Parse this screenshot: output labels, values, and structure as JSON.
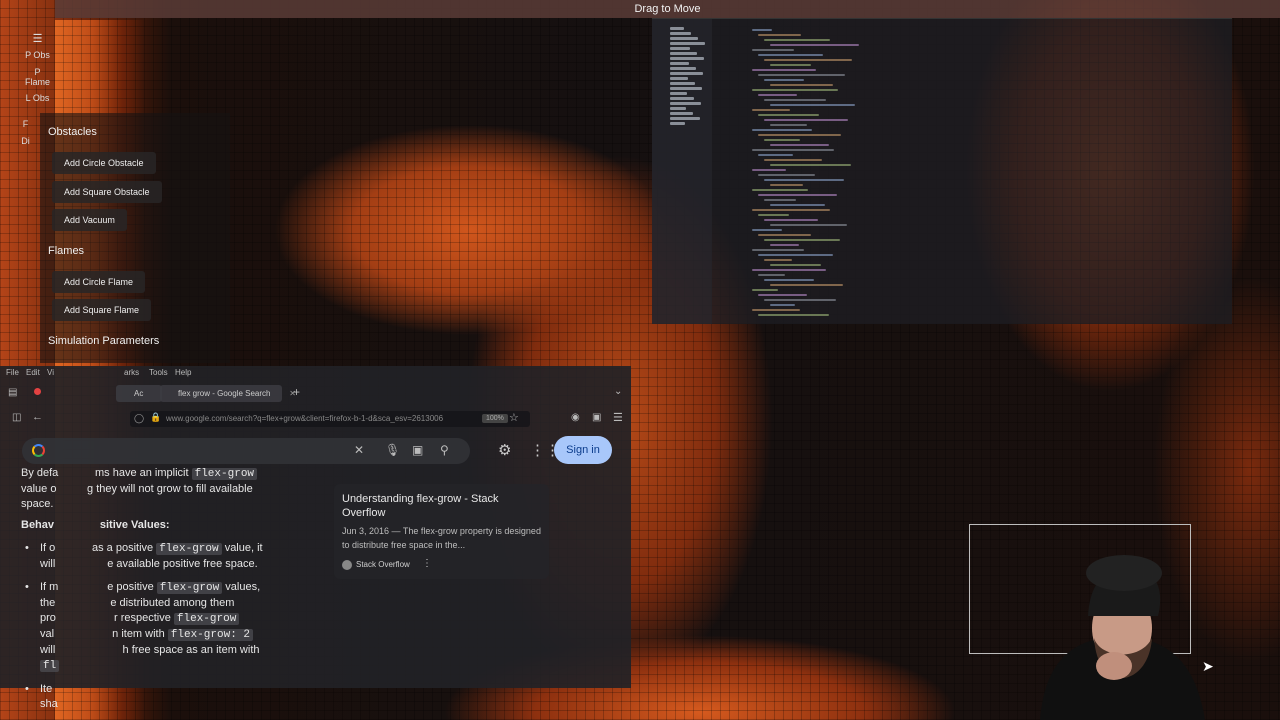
{
  "drag_bar": {
    "label": "Drag to Move"
  },
  "mini_toolbar": {
    "menu_icon": "hamburger-icon",
    "items": [
      "P Obs",
      "P",
      "Flame",
      "L Obs",
      "F",
      "Di"
    ]
  },
  "panel": {
    "obstacles_title": "Obstacles",
    "obstacle_buttons": [
      "Add Circle Obstacle",
      "Add Square Obstacle",
      "Add Vacuum"
    ],
    "flames_title": "Flames",
    "flame_buttons": [
      "Add Circle Flame",
      "Add Square Flame"
    ],
    "sim_params_title": "Simulation Parameters"
  },
  "browser": {
    "menu": [
      "File",
      "Edit",
      "Vi",
      "arks",
      "Tools",
      "Help"
    ],
    "tabs": [
      "Ac",
      "flex grow - Google Search"
    ],
    "url": "www.google.com/search?q=flex+grow&client=firefox-b-1-d&sca_esv=2613006",
    "zoom": "100%",
    "signin_label": "Sign in",
    "colors": {
      "signin_bg": "#a8c7fa",
      "accent": "#e06622"
    },
    "body": {
      "p1_a": "By defa",
      "p1_b": "ms have an implicit",
      "p1_code": "flex-grow",
      "p1_c": "value o",
      "p1_d": "g they will not grow to fill available",
      "p1_e": "space.",
      "h_a": "Behav",
      "h_b": "sitive Values:",
      "li1_a": "If o",
      "li1_b": "as a positive",
      "li1_code": "flex-grow",
      "li1_c": "value, it",
      "li1_d": "will",
      "li1_e": "e available positive free space.",
      "li2_a": "If m",
      "li2_b": "e positive",
      "li2_code": "flex-grow",
      "li2_c": "values,",
      "li2_d": "the",
      "li2_e": "e distributed among them",
      "li2_f": "pro",
      "li2_g": "r respective",
      "li2_code2": "flex-grow",
      "li2_h": "val",
      "li2_i": "n item with",
      "li2_code3": "flex-grow: 2",
      "li2_j": "will",
      "li2_k": "h free space as an item with",
      "li2_code4": "fl",
      "li3_a": "Ite",
      "li3_b": "sha"
    },
    "result": {
      "title": "Understanding flex-grow - Stack Overflow",
      "snippet": "Jun 3, 2016 — The flex-grow property is designed to distribute free space in the...",
      "source": "Stack Overflow"
    }
  }
}
